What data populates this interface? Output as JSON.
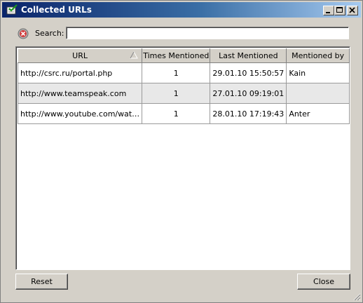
{
  "window": {
    "title": "Collected URLs"
  },
  "search": {
    "label": "Search:",
    "value": ""
  },
  "table": {
    "columns": [
      "URL",
      "Times Mentioned",
      "Last Mentioned",
      "Mentioned by"
    ],
    "sort_column": "URL",
    "sort_direction": "ascending",
    "rows": [
      {
        "url": "http://csrc.ru/portal.php",
        "times": "1",
        "last": "29.01.10 15:50:57",
        "by": "Kain"
      },
      {
        "url": "http://www.teamspeak.com",
        "times": "1",
        "last": "27.01.10 09:19:01",
        "by": ""
      },
      {
        "url": "http://www.youtube.com/wat…",
        "times": "1",
        "last": "28.01.10 17:19:43",
        "by": "Anter"
      }
    ]
  },
  "buttons": {
    "reset": "Reset",
    "close": "Close"
  },
  "icons": {
    "app": "url-list-check-icon",
    "clear_search": "clear-search-icon",
    "sort": "sort-ascending-icon",
    "minimize": "minimize-icon",
    "maximize": "maximize-icon",
    "close": "close-icon",
    "resize": "resize-grip-icon"
  },
  "colors": {
    "title_bar": "#0a246a",
    "title_bar_end": "#a6caf0",
    "face": "#d4d0c8",
    "alt_row": "#e8e8e8"
  }
}
